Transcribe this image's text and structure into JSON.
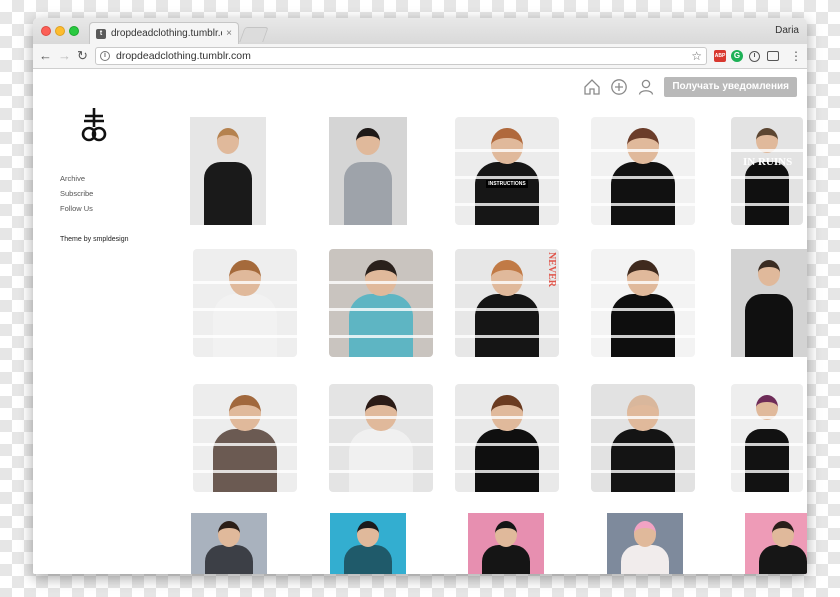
{
  "browser": {
    "tab_title": "dropdeadclothing.tumblr.com",
    "tab_close": "×",
    "user_name": "Daria",
    "url": "dropdeadclothing.tumblr.com",
    "nav": {
      "back": "←",
      "forward": "→",
      "reload": "↻"
    },
    "star": "☆",
    "menu": "⋮"
  },
  "header": {
    "notify_button": "Получать уведомления",
    "icons": [
      "home-icon",
      "add-icon",
      "user-icon"
    ]
  },
  "sidebar": {
    "links": [
      "Archive",
      "Subscribe",
      "Follow Us"
    ],
    "credit": "Theme by smpldesign"
  },
  "grid": {
    "rows": [
      [
        {
          "bg": "#e6e6e6",
          "shirt": "#1a1a1a",
          "hair": "#b5824f",
          "torn": false
        },
        {
          "bg": "#d5d5d5",
          "shirt": "#9ea3aa",
          "hair": "#1f1a18",
          "torn": false
        },
        {
          "bg": "#ececec",
          "shirt": "#161616",
          "hair": "#b0693c",
          "torn": true,
          "tag": "INSTRUCTIONS"
        },
        {
          "bg": "#f1f1f1",
          "shirt": "#111111",
          "hair": "#6b3d2a",
          "torn": true
        },
        {
          "bg": "#e3e3e3",
          "shirt": "#101010",
          "hair": "#5c4632",
          "torn": true,
          "text": "IN RUINS"
        }
      ],
      [
        {
          "bg": "#eeeeee",
          "shirt": "#f2f2f2",
          "hair": "#a56a3b",
          "torn": true
        },
        {
          "bg": "#c9c4bf",
          "shirt": "#5eb5c3",
          "hair": "#2a211c",
          "torn": true
        },
        {
          "bg": "#e7e7e7",
          "shirt": "#151515",
          "hair": "#c17a45",
          "torn": true,
          "text": "NEVER"
        },
        {
          "bg": "#f3f3f3",
          "shirt": "#0e0e0e",
          "hair": "#3f2a1e",
          "torn": true
        },
        {
          "bg": "#d3d3d3",
          "shirt": "#101010",
          "hair": "#3a2c22",
          "torn": false
        }
      ],
      [
        {
          "bg": "#ededed",
          "shirt": "#6b5a52",
          "hair": "#a1683d",
          "torn": true
        },
        {
          "bg": "#e4e4e4",
          "shirt": "#f0f0f0",
          "hair": "#2b1b16",
          "torn": true
        },
        {
          "bg": "#e9e9e9",
          "shirt": "#0f0f0f",
          "hair": "#6b3b20",
          "torn": true
        },
        {
          "bg": "#e2e2e2",
          "shirt": "#141414",
          "hair": "#d9b79c",
          "torn": true
        },
        {
          "bg": "#eeeeee",
          "shirt": "#121212",
          "hair": "#6e2b58",
          "torn": true
        }
      ],
      [
        {
          "bg": "#a9b2be",
          "shirt": "#3c3f46",
          "hair": "#2b1e17",
          "torn": false
        },
        {
          "bg": "#33aed0",
          "shirt": "#1f5a6a",
          "hair": "#1b1b1b",
          "torn": false
        },
        {
          "bg": "#e78fb0",
          "shirt": "#151515",
          "hair": "#151515",
          "torn": false
        },
        {
          "bg": "#7e8a9c",
          "shirt": "#f1ecec",
          "hair": "#f2a3c4",
          "torn": false
        },
        {
          "bg": "#ee9bb7",
          "shirt": "#161616",
          "hair": "#2a1e1a",
          "torn": false
        }
      ]
    ]
  }
}
